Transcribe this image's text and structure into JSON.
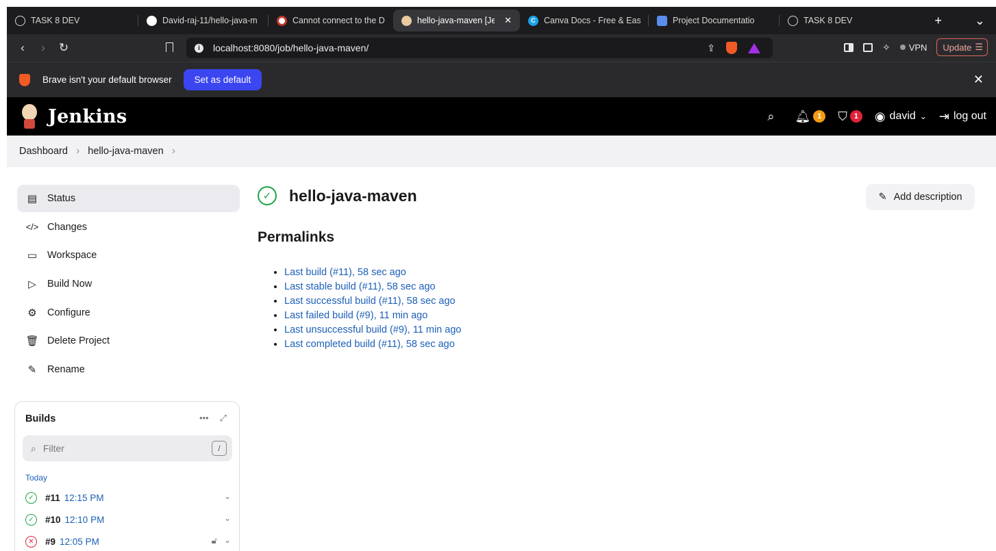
{
  "browser": {
    "tabs": [
      {
        "label": "TASK 8 DEV",
        "icon": "globe-icon",
        "active": false
      },
      {
        "label": "David-raj-11/hello-java-m",
        "icon": "github-icon",
        "active": false
      },
      {
        "label": "Cannot connect to the D",
        "icon": "warning-favicon",
        "active": false
      },
      {
        "label": "hello-java-maven [Je",
        "icon": "jenkins-favicon",
        "active": true
      },
      {
        "label": "Canva Docs - Free & Eas",
        "icon": "canva-icon",
        "active": false
      },
      {
        "label": "Project Documentatio",
        "icon": "doc-icon",
        "active": false
      },
      {
        "label": "TASK 8 DEV",
        "icon": "globe-icon",
        "active": false
      }
    ],
    "new_tab_glyph": "+",
    "tab_menu_glyph": "⌄",
    "url": "localhost:8080/job/hello-java-maven/",
    "vpn_label": "VPN",
    "update_label": "Update",
    "banner": {
      "message": "Brave isn't your default browser",
      "button": "Set as default"
    }
  },
  "jenkins": {
    "brand": "Jenkins",
    "notifications_count": "1",
    "security_count": "1",
    "user": "david",
    "logout": "log out",
    "breadcrumbs": [
      "Dashboard",
      "hello-java-maven"
    ],
    "sidebar": [
      {
        "label": "Status",
        "icon": "document-icon",
        "active": true
      },
      {
        "label": "Changes",
        "icon": "code-icon",
        "active": false
      },
      {
        "label": "Workspace",
        "icon": "folder-icon",
        "active": false
      },
      {
        "label": "Build Now",
        "icon": "play-icon",
        "active": false
      },
      {
        "label": "Configure",
        "icon": "gear-icon",
        "active": false
      },
      {
        "label": "Delete Project",
        "icon": "trash-icon",
        "active": false
      },
      {
        "label": "Rename",
        "icon": "pencil-icon",
        "active": false
      }
    ],
    "builds": {
      "title": "Builds",
      "filter_placeholder": "Filter",
      "filter_shortcut": "/",
      "group": "Today",
      "items": [
        {
          "number": "#11",
          "time": "12:15 PM",
          "status": "success"
        },
        {
          "number": "#10",
          "time": "12:10 PM",
          "status": "success"
        },
        {
          "number": "#9",
          "time": "12:05 PM",
          "status": "failed"
        }
      ]
    },
    "project_title": "hello-java-maven",
    "add_description": "Add description",
    "permalinks_heading": "Permalinks",
    "permalinks": [
      "Last build (#11), 58 sec ago",
      "Last stable build (#11), 58 sec ago",
      "Last successful build (#11), 58 sec ago",
      "Last failed build (#9), 11 min ago",
      "Last unsuccessful build (#9), 11 min ago",
      "Last completed build (#11), 58 sec ago"
    ],
    "colors": {
      "link": "#1c5fb8",
      "success": "#1ea446",
      "failure": "#e0233a",
      "header_bg": "#000000"
    }
  }
}
